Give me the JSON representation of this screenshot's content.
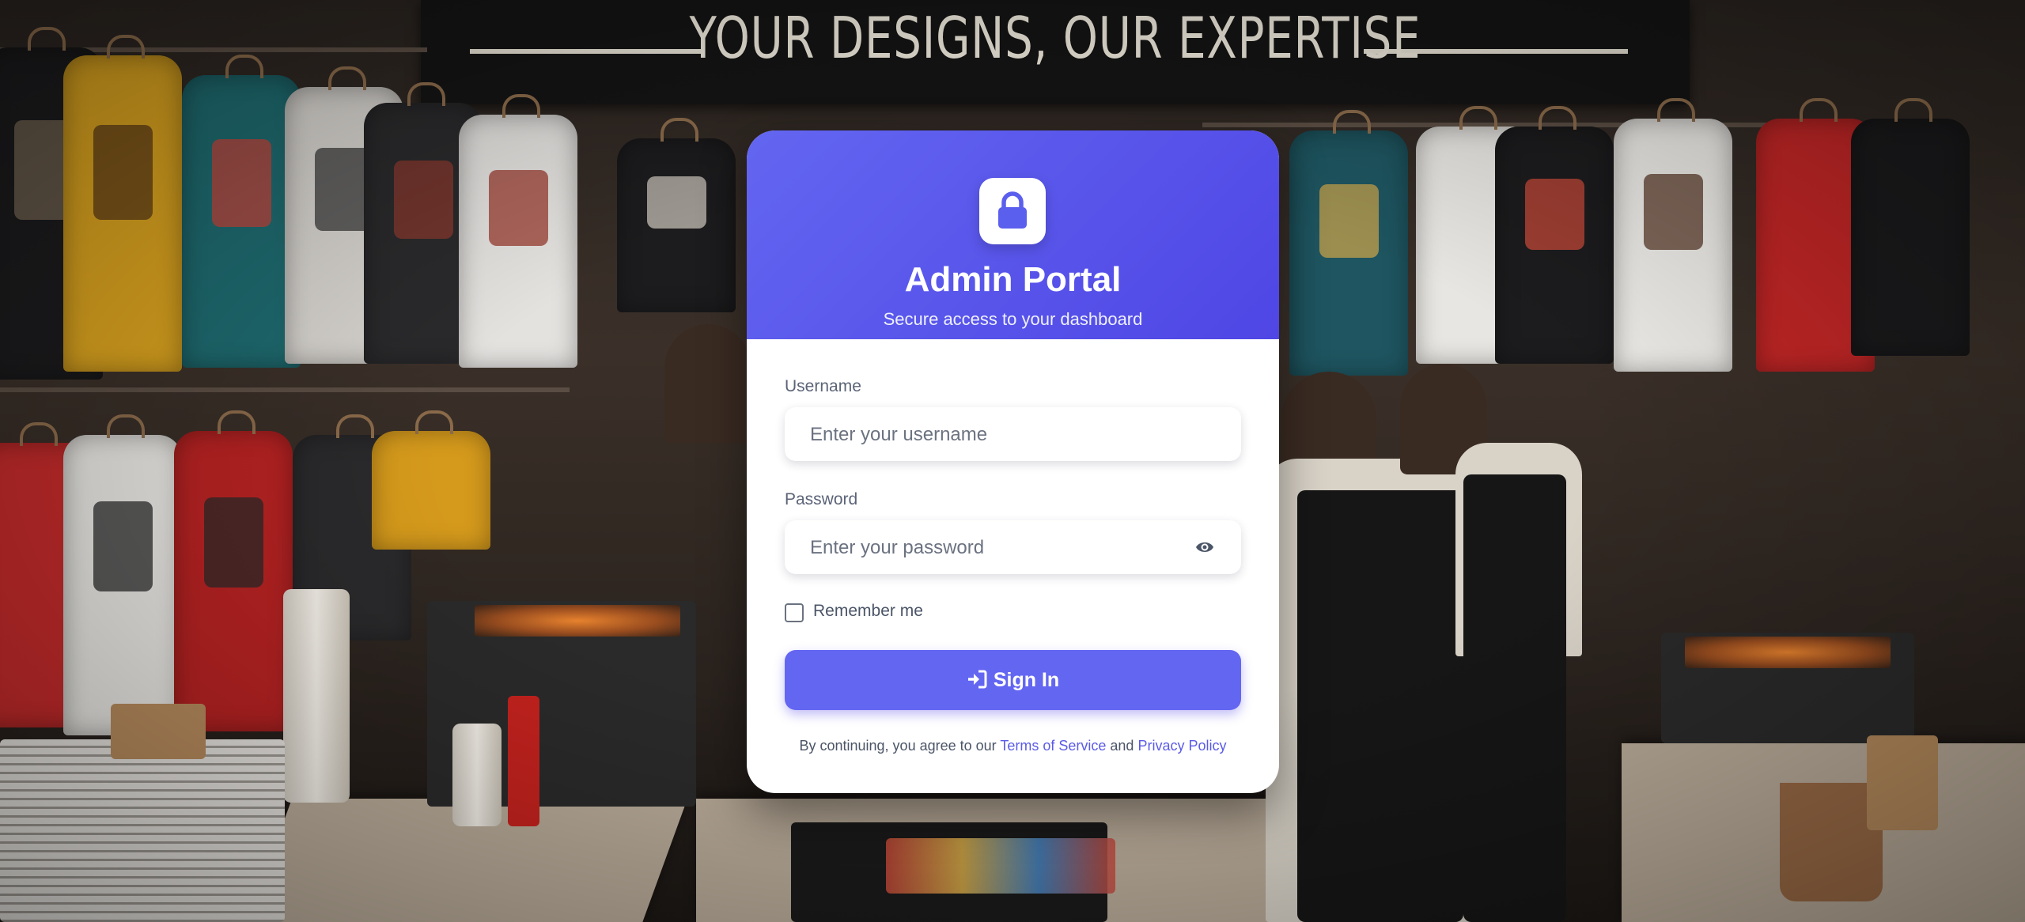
{
  "background": {
    "banner_text": "YOUR DESIGNS, OUR EXPERTISE"
  },
  "login": {
    "icon": "lock-icon",
    "title": "Admin Portal",
    "subtitle": "Secure access to your dashboard",
    "username": {
      "label": "Username",
      "placeholder": "Enter your username",
      "value": ""
    },
    "password": {
      "label": "Password",
      "placeholder": "Enter your password",
      "value": "",
      "toggle_icon": "eye-icon"
    },
    "remember_label": "Remember me",
    "remember_checked": false,
    "submit_label": "Sign In",
    "submit_icon": "sign-in-icon",
    "footer_prefix": "By continuing, you agree to our",
    "terms_link": "Terms of Service",
    "footer_and": "and",
    "privacy_link": "Privacy Policy"
  },
  "colors": {
    "accent": "#6366f1",
    "accent_dark": "#4f46e5",
    "link": "#5b5be6"
  }
}
